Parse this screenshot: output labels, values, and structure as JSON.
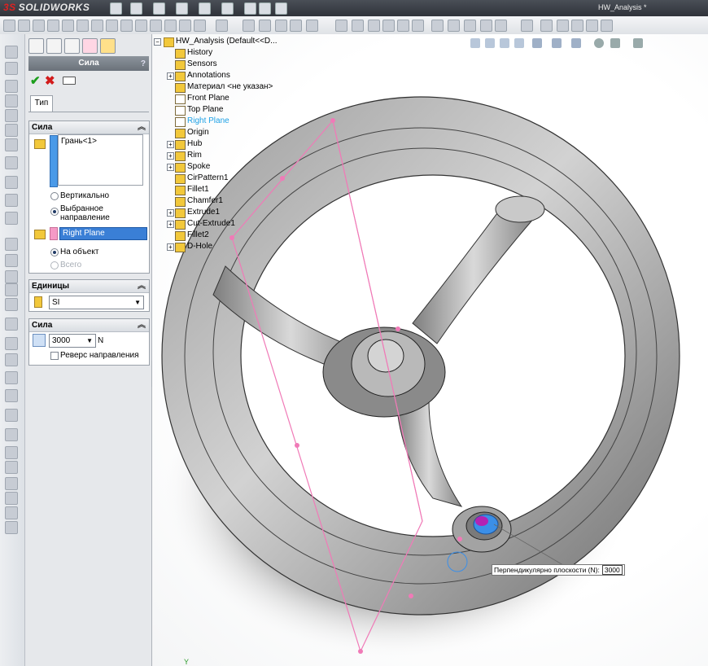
{
  "app": {
    "logo_text": "SOLIDWORKS",
    "logo_prefix": "3S",
    "document_title": "HW_Analysis *"
  },
  "property_manager": {
    "title": "Сила",
    "help_icon": "?",
    "tab_label": "Тип",
    "force_group": {
      "heading": "Сила",
      "faces_list": [
        "Грань<1>"
      ],
      "radio_vertical": "Вертикально",
      "radio_selected_direction": "Выбранное направление",
      "direction_reference": "Right Plane",
      "radio_per_object": "На объект",
      "radio_total": "Всего"
    },
    "units_group": {
      "heading": "Единицы",
      "unit_system": "SI"
    },
    "magnitude_group": {
      "heading": "Сила",
      "value": "3000",
      "unit": "N",
      "reverse_label": "Реверс направления"
    }
  },
  "feature_tree": {
    "root": "HW_Analysis  (Default<<D...",
    "items": [
      {
        "label": "History",
        "icon": "history-icon"
      },
      {
        "label": "Sensors",
        "icon": "sensors-icon"
      },
      {
        "label": "Annotations",
        "icon": "annotations-icon"
      },
      {
        "label": "Материал <не указан>",
        "icon": "material-icon"
      },
      {
        "label": "Front Plane",
        "icon": "plane-icon"
      },
      {
        "label": "Top Plane",
        "icon": "plane-icon"
      },
      {
        "label": "Right Plane",
        "icon": "plane-icon"
      },
      {
        "label": "Origin",
        "icon": "origin-icon"
      },
      {
        "label": "Hub",
        "icon": "feature-icon"
      },
      {
        "label": "Rim",
        "icon": "feature-icon"
      },
      {
        "label": "Spoke",
        "icon": "feature-icon"
      },
      {
        "label": "CirPattern1",
        "icon": "pattern-icon"
      },
      {
        "label": "Fillet1",
        "icon": "fillet-icon"
      },
      {
        "label": "Chamfer1",
        "icon": "chamfer-icon"
      },
      {
        "label": "Extrude1",
        "icon": "extrude-icon"
      },
      {
        "label": "Cut-Extrude1",
        "icon": "cut-extrude-icon"
      },
      {
        "label": "Fillet2",
        "icon": "fillet-icon"
      },
      {
        "label": "D-Hole",
        "icon": "hole-icon"
      }
    ]
  },
  "viewport": {
    "callout_label": "Перпендикулярно плоскости (N):",
    "callout_value": "3000",
    "triad_axis": "Y"
  },
  "colors": {
    "accent_selection": "#3a7fd6",
    "direction_plane": "#f07ab7",
    "force_face": "#3b8fe8"
  }
}
